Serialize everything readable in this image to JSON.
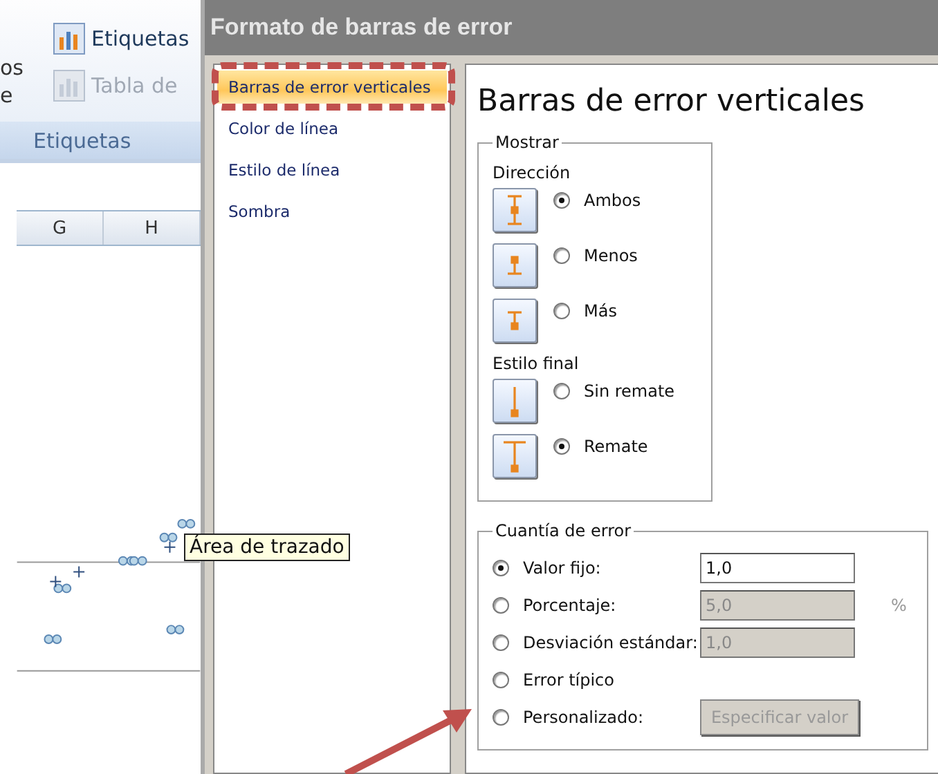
{
  "sheet": {
    "cut_texts": [
      "os",
      "e"
    ],
    "ribbon_buttons": [
      {
        "label": "Etiquetas",
        "disabled": false
      },
      {
        "label": "Tabla de",
        "disabled": true
      }
    ],
    "group_label": "Etiquetas",
    "columns": [
      "G",
      "H"
    ],
    "tooltip": "Área de trazado"
  },
  "dialog": {
    "title": "Formato de barras de error",
    "nav": [
      {
        "label": "Barras de error verticales",
        "selected": true
      },
      {
        "label": "Color de línea",
        "selected": false
      },
      {
        "label": "Estilo de línea",
        "selected": false
      },
      {
        "label": "Sombra",
        "selected": false
      }
    ],
    "heading": "Barras de error verticales",
    "show_group": {
      "title": "Mostrar",
      "sections": [
        {
          "title": "Dirección",
          "options": [
            {
              "label": "Ambos",
              "checked": true
            },
            {
              "label": "Menos",
              "checked": false
            },
            {
              "label": "Más",
              "checked": false
            }
          ]
        },
        {
          "title": "Estilo final",
          "options": [
            {
              "label": "Sin remate",
              "checked": false
            },
            {
              "label": "Remate",
              "checked": true
            }
          ]
        }
      ]
    },
    "amount_group": {
      "title": "Cuantía de error",
      "options": [
        {
          "kind": "field",
          "label": "Valor fijo:",
          "checked": true,
          "value": "1,0",
          "disabled": false
        },
        {
          "kind": "field",
          "label": "Porcentaje:",
          "checked": false,
          "value": "5,0",
          "disabled": true,
          "unit": "%"
        },
        {
          "kind": "field",
          "label": "Desviación estándar:",
          "checked": false,
          "value": "1,0",
          "disabled": true
        },
        {
          "kind": "plain",
          "label": "Error típico",
          "checked": false
        },
        {
          "kind": "button",
          "label": "Personalizado:",
          "checked": false,
          "button": "Especificar valor",
          "disabled": true
        }
      ]
    }
  }
}
